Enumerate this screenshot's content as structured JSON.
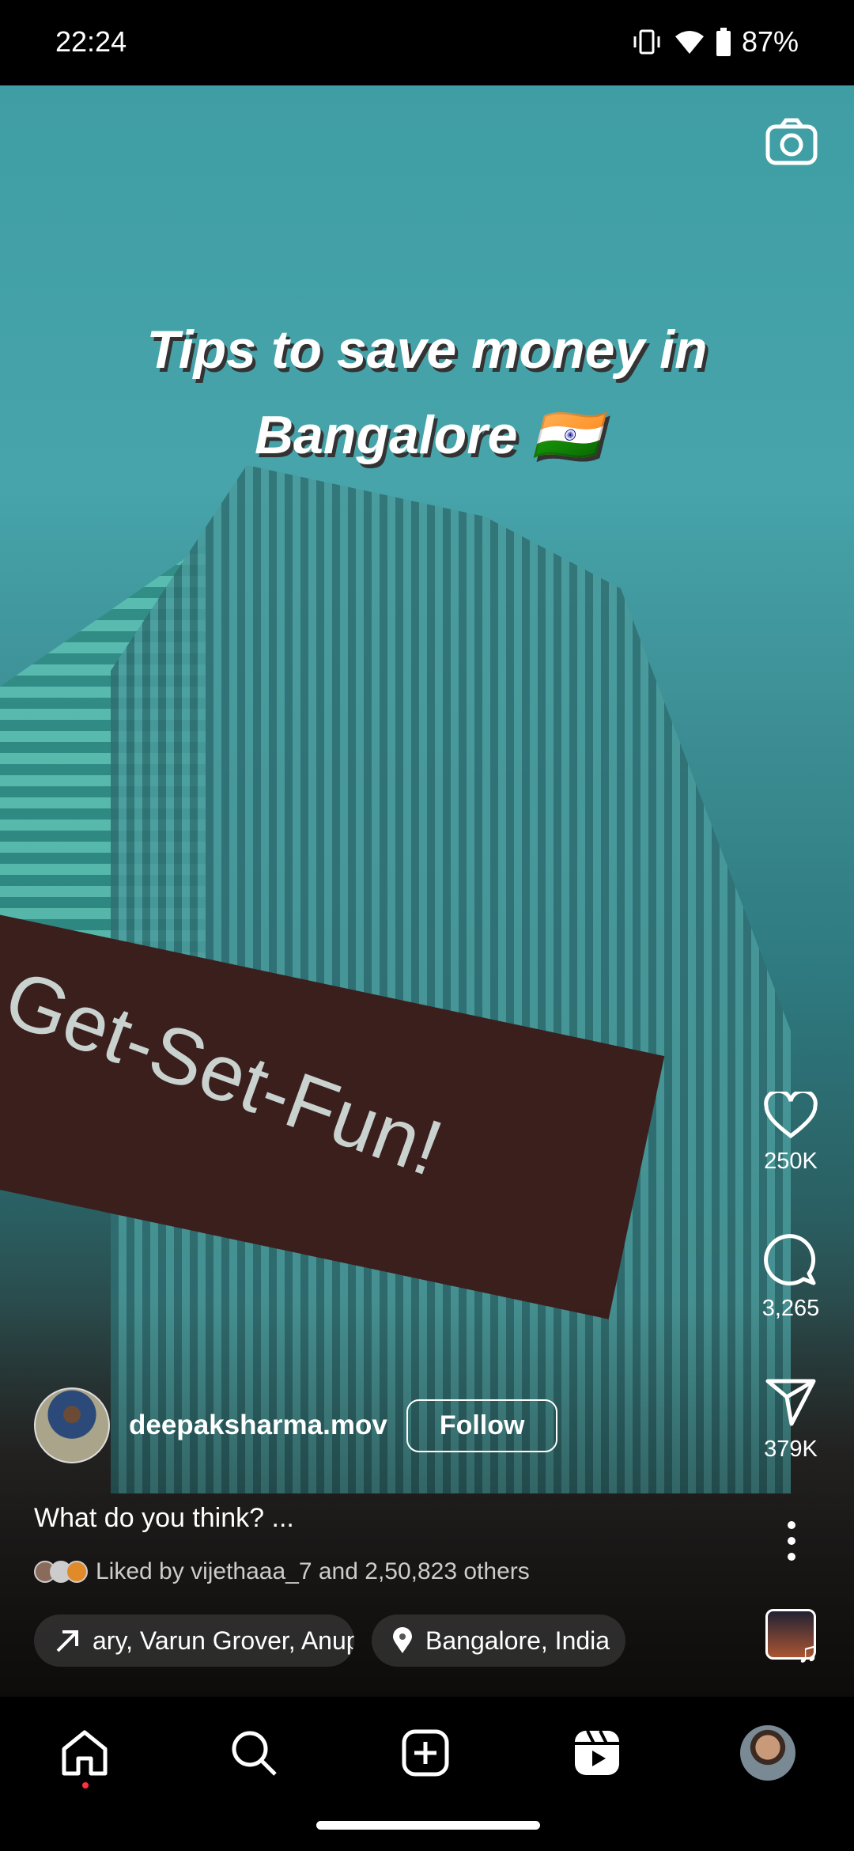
{
  "status_bar": {
    "time": "22:24",
    "battery": "87%",
    "icons": [
      "vibrate-icon",
      "wifi-icon",
      "battery-icon"
    ]
  },
  "reel": {
    "overlay_title_line1": "Tips to save money in",
    "overlay_title_line2": "Bangalore 🇮🇳",
    "scene_sign_text": "Get-Set-Fun!",
    "likes": "250K",
    "comments": "3,265",
    "shares": "379K",
    "username": "deepaksharma.mov",
    "follow_label": "Follow",
    "caption": "What do you think? ...",
    "liked_by": "Liked by vijethaaa_7 and 2,50,823 others",
    "collab_pill": "ary, Varun Grover, Anup",
    "location_pill": "Bangalore, India"
  },
  "nav": {
    "items": [
      "home",
      "search",
      "create",
      "reels",
      "profile"
    ]
  },
  "colors": {
    "notification_dot": "#ff3040",
    "background": "#000000"
  }
}
